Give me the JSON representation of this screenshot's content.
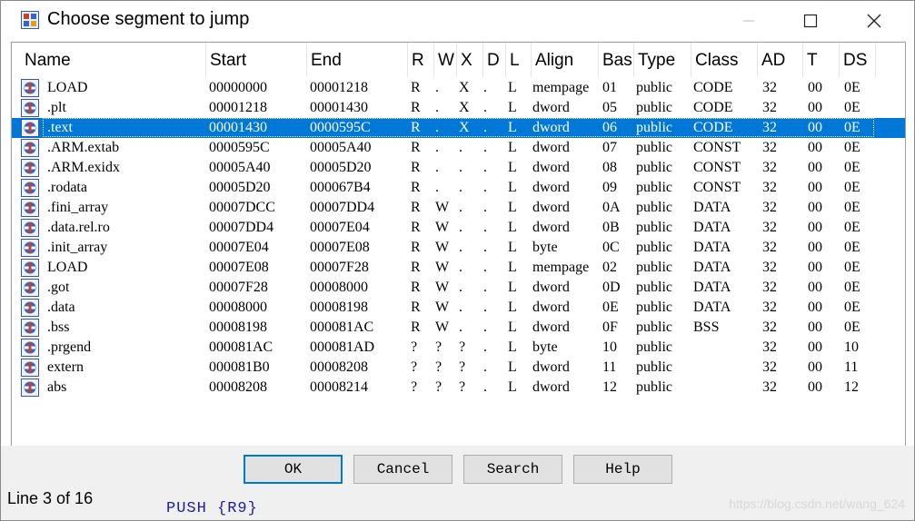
{
  "window": {
    "title": "Choose segment to jump"
  },
  "columns": [
    "Name",
    "Start",
    "End",
    "R",
    "W",
    "X",
    "D",
    "L",
    "Align",
    "Bas",
    "Type",
    "Class",
    "AD",
    "T",
    "DS"
  ],
  "rows": [
    {
      "name": "LOAD",
      "start": "00000000",
      "end": "00001218",
      "r": "R",
      "w": ".",
      "x": "X",
      "d": ".",
      "l": "L",
      "align": "mempage",
      "base": "01",
      "type": "public",
      "class": "CODE",
      "ad": "32",
      "t": "00",
      "ds": "0E"
    },
    {
      "name": ".plt",
      "start": "00001218",
      "end": "00001430",
      "r": "R",
      "w": ".",
      "x": "X",
      "d": ".",
      "l": "L",
      "align": "dword",
      "base": "05",
      "type": "public",
      "class": "CODE",
      "ad": "32",
      "t": "00",
      "ds": "0E"
    },
    {
      "name": ".text",
      "start": "00001430",
      "end": "0000595C",
      "r": "R",
      "w": ".",
      "x": "X",
      "d": ".",
      "l": "L",
      "align": "dword",
      "base": "06",
      "type": "public",
      "class": "CODE",
      "ad": "32",
      "t": "00",
      "ds": "0E"
    },
    {
      "name": ".ARM.extab",
      "start": "0000595C",
      "end": "00005A40",
      "r": "R",
      "w": ".",
      "x": ".",
      "d": ".",
      "l": "L",
      "align": "dword",
      "base": "07",
      "type": "public",
      "class": "CONST",
      "ad": "32",
      "t": "00",
      "ds": "0E"
    },
    {
      "name": ".ARM.exidx",
      "start": "00005A40",
      "end": "00005D20",
      "r": "R",
      "w": ".",
      "x": ".",
      "d": ".",
      "l": "L",
      "align": "dword",
      "base": "08",
      "type": "public",
      "class": "CONST",
      "ad": "32",
      "t": "00",
      "ds": "0E"
    },
    {
      "name": ".rodata",
      "start": "00005D20",
      "end": "000067B4",
      "r": "R",
      "w": ".",
      "x": ".",
      "d": ".",
      "l": "L",
      "align": "dword",
      "base": "09",
      "type": "public",
      "class": "CONST",
      "ad": "32",
      "t": "00",
      "ds": "0E"
    },
    {
      "name": ".fini_array",
      "start": "00007DCC",
      "end": "00007DD4",
      "r": "R",
      "w": "W",
      "x": ".",
      "d": ".",
      "l": "L",
      "align": "dword",
      "base": "0A",
      "type": "public",
      "class": "DATA",
      "ad": "32",
      "t": "00",
      "ds": "0E"
    },
    {
      "name": ".data.rel.ro",
      "start": "00007DD4",
      "end": "00007E04",
      "r": "R",
      "w": "W",
      "x": ".",
      "d": ".",
      "l": "L",
      "align": "dword",
      "base": "0B",
      "type": "public",
      "class": "DATA",
      "ad": "32",
      "t": "00",
      "ds": "0E"
    },
    {
      "name": ".init_array",
      "start": "00007E04",
      "end": "00007E08",
      "r": "R",
      "w": "W",
      "x": ".",
      "d": ".",
      "l": "L",
      "align": "byte",
      "base": "0C",
      "type": "public",
      "class": "DATA",
      "ad": "32",
      "t": "00",
      "ds": "0E"
    },
    {
      "name": "LOAD",
      "start": "00007E08",
      "end": "00007F28",
      "r": "R",
      "w": "W",
      "x": ".",
      "d": ".",
      "l": "L",
      "align": "mempage",
      "base": "02",
      "type": "public",
      "class": "DATA",
      "ad": "32",
      "t": "00",
      "ds": "0E"
    },
    {
      "name": ".got",
      "start": "00007F28",
      "end": "00008000",
      "r": "R",
      "w": "W",
      "x": ".",
      "d": ".",
      "l": "L",
      "align": "dword",
      "base": "0D",
      "type": "public",
      "class": "DATA",
      "ad": "32",
      "t": "00",
      "ds": "0E"
    },
    {
      "name": ".data",
      "start": "00008000",
      "end": "00008198",
      "r": "R",
      "w": "W",
      "x": ".",
      "d": ".",
      "l": "L",
      "align": "dword",
      "base": "0E",
      "type": "public",
      "class": "DATA",
      "ad": "32",
      "t": "00",
      "ds": "0E"
    },
    {
      "name": ".bss",
      "start": "00008198",
      "end": "000081AC",
      "r": "R",
      "w": "W",
      "x": ".",
      "d": ".",
      "l": "L",
      "align": "dword",
      "base": "0F",
      "type": "public",
      "class": "BSS",
      "ad": "32",
      "t": "00",
      "ds": "0E"
    },
    {
      "name": ".prgend",
      "start": "000081AC",
      "end": "000081AD",
      "r": "?",
      "w": "?",
      "x": "?",
      "d": ".",
      "l": "L",
      "align": "byte",
      "base": "10",
      "type": "public",
      "class": "",
      "ad": "32",
      "t": "00",
      "ds": "10"
    },
    {
      "name": "extern",
      "start": "000081B0",
      "end": "00008208",
      "r": "?",
      "w": "?",
      "x": "?",
      "d": ".",
      "l": "L",
      "align": "dword",
      "base": "11",
      "type": "public",
      "class": "",
      "ad": "32",
      "t": "00",
      "ds": "11"
    },
    {
      "name": "abs",
      "start": "00008208",
      "end": "00008214",
      "r": "?",
      "w": "?",
      "x": "?",
      "d": ".",
      "l": "L",
      "align": "dword",
      "base": "12",
      "type": "public",
      "class": "",
      "ad": "32",
      "t": "00",
      "ds": "12"
    }
  ],
  "selected_row": 2,
  "buttons": {
    "ok": "OK",
    "cancel": "Cancel",
    "search": "Search",
    "help": "Help"
  },
  "status": "Line 3 of 16",
  "background_code": "PUSH    {R9}",
  "watermark": "https://blog.csdn.net/wang_624",
  "colors": {
    "selection": "#0078d7",
    "icon_blue": "#3366cc",
    "icon_red": "#d04020"
  }
}
